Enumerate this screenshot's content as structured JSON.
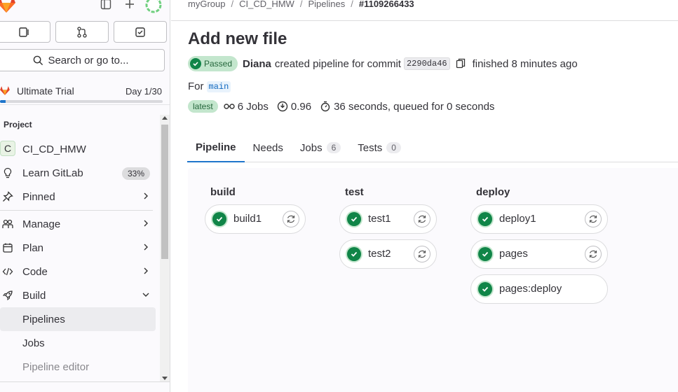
{
  "colors": {
    "accent": "#1f75cb",
    "success": "#108548",
    "success_bg": "#c3e6cd"
  },
  "sidebar": {
    "search_label": "Search or go to...",
    "trial": {
      "name": "Ultimate Trial",
      "day": "Day 1/30",
      "progress": 0.033
    },
    "section_title": "Project",
    "project": {
      "avatar": "C",
      "name": "CI_CD_HMW"
    },
    "learn": {
      "label": "Learn GitLab",
      "percent": "33%"
    },
    "pinned": "Pinned",
    "items": [
      {
        "label": "Manage",
        "icon": "users-icon"
      },
      {
        "label": "Plan",
        "icon": "calendar-icon"
      },
      {
        "label": "Code",
        "icon": "code-icon"
      },
      {
        "label": "Build",
        "icon": "rocket-icon"
      }
    ],
    "sub_items": [
      "Pipelines",
      "Jobs",
      "Pipeline editor"
    ]
  },
  "breadcrumb": [
    "myGroup",
    "CI_CD_HMW",
    "Pipelines",
    "#1109266433"
  ],
  "pipeline": {
    "title": "Add new file",
    "status": "Passed",
    "author": "Diana",
    "created_text": "created pipeline for commit",
    "commit": "2290da46",
    "finished": "finished 8 minutes ago",
    "for_label": "For",
    "branch": "main",
    "latest": "latest",
    "jobs_text": "6 Jobs",
    "duration_ratio": "0.96",
    "time_text": "36 seconds, queued for 0 seconds"
  },
  "tabs": [
    {
      "label": "Pipeline",
      "count": null
    },
    {
      "label": "Needs",
      "count": null
    },
    {
      "label": "Jobs",
      "count": "6"
    },
    {
      "label": "Tests",
      "count": "0"
    }
  ],
  "stages": [
    {
      "name": "build",
      "jobs": [
        "build1"
      ]
    },
    {
      "name": "test",
      "jobs": [
        "test1",
        "test2"
      ]
    },
    {
      "name": "deploy",
      "jobs": [
        "deploy1",
        "pages",
        "pages:deploy"
      ]
    }
  ]
}
